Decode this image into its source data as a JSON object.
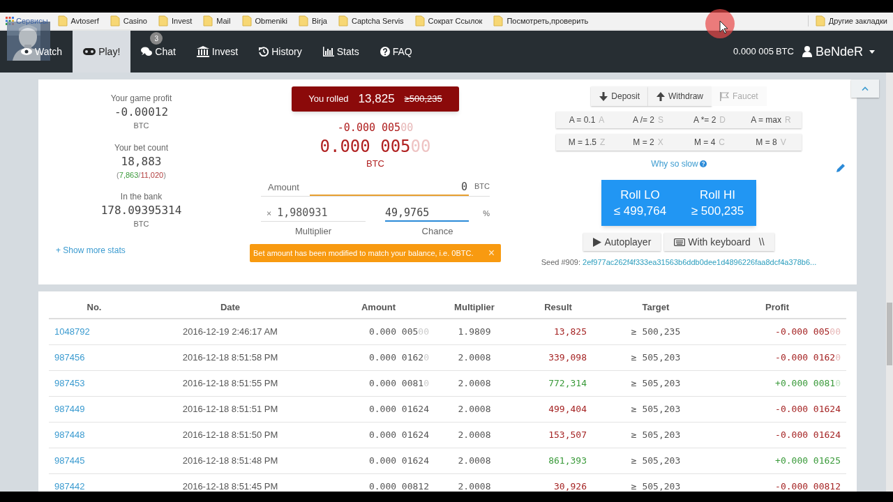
{
  "bookmarks_bar": {
    "apps_label": "Сервисы",
    "items": [
      "Avtoserf",
      "Casino",
      "Invest",
      "Mail",
      "Obmeniki",
      "Birja",
      "Captcha Servis",
      "Сократ Ссылок",
      "Посмотреть,проверить"
    ],
    "other": "Другие закладки"
  },
  "nav": {
    "items": [
      {
        "kind": "eye",
        "label": "Watch",
        "selected": false
      },
      {
        "kind": "gamepad",
        "label": "Play!",
        "selected": true
      },
      {
        "kind": "chat",
        "label": "Chat",
        "selected": false,
        "badge": "3"
      },
      {
        "kind": "bank",
        "label": "Invest",
        "selected": false
      },
      {
        "kind": "history",
        "label": "History",
        "selected": false
      },
      {
        "kind": "chart",
        "label": "Stats",
        "selected": false
      },
      {
        "kind": "question",
        "label": "FAQ",
        "selected": false
      }
    ],
    "balance": "0.000 005",
    "balance_unit": "BTC",
    "user": "BeNdeR"
  },
  "stats": [
    {
      "label": "Your game profit",
      "value": "-0.00012",
      "unit": "BTC"
    },
    {
      "label": "Your bet count",
      "value": "18,883",
      "bracket_open": "(",
      "wins": "7,863",
      "separator": "/",
      "losses": "11,020",
      "bracket_close": ")"
    },
    {
      "label": "In the bank",
      "value": "178.09395314",
      "unit": "BTC"
    }
  ],
  "show_more": "+ Show more stats",
  "roll_result": {
    "label": "You rolled",
    "value": "13,825",
    "target": "≥500,235",
    "met": false
  },
  "last_profit": {
    "text": "-0.000 005",
    "faded": "00"
  },
  "payout": {
    "text": "0.000 005",
    "faded": "00",
    "unit": "BTC"
  },
  "amount_field": {
    "label": "Amount",
    "value": "0",
    "unit": "BTC"
  },
  "multiplier_field": {
    "prefix": "×",
    "value": "1,980931",
    "label": "Multiplier"
  },
  "chance_field": {
    "value": "49,9765",
    "unit": "%",
    "label": "Chance"
  },
  "alert": {
    "text": "Bet amount has been modified to match your balance, i.e. 0BTC.",
    "close": "×"
  },
  "wallet_buttons": [
    {
      "kind": "down",
      "label": "Deposit",
      "disabled": false
    },
    {
      "kind": "up",
      "label": "Withdraw",
      "disabled": false
    },
    {
      "kind": "flag",
      "label": "Faucet",
      "disabled": true
    }
  ],
  "amount_shortcuts": [
    [
      {
        "label": "A = 0.1",
        "key": "A"
      },
      {
        "label": "A /= 2",
        "key": "S"
      },
      {
        "label": "A *= 2",
        "key": "D"
      },
      {
        "label": "A = max",
        "key": "R"
      }
    ],
    [
      {
        "label": "M = 1.5",
        "key": "Z"
      },
      {
        "label": "M = 2",
        "key": "X"
      },
      {
        "label": "M = 4",
        "key": "C"
      },
      {
        "label": "M = 8",
        "key": "V"
      }
    ]
  ],
  "why_slow": "Why so slow",
  "roll_buttons": [
    {
      "label": "Roll LO",
      "target": "≤ 499,764"
    },
    {
      "label": "Roll HI",
      "target": "≥ 500,235"
    }
  ],
  "mode_buttons": [
    {
      "kind": "play",
      "label": "Autoplayer"
    },
    {
      "kind": "keyboard",
      "label": "With keyboard",
      "key": "\\\\"
    }
  ],
  "seed": {
    "label": "Seed #909:",
    "hash": "2ef977ac262f4f333ea31563b6ddb0dee1d4896226faa8dcf4a378b6..."
  },
  "table": {
    "columns": [
      "No.",
      "Date",
      "Amount",
      "Multiplier",
      "Result",
      "Target",
      "Profit"
    ],
    "rows": [
      {
        "no": "1048792",
        "date": "2016-12-19 2:46:17 AM",
        "amount": {
          "text": "0.000 005",
          "faded": "00"
        },
        "multiplier": "1.9809",
        "result": "13,825",
        "target": "≥ 500,235",
        "profit": {
          "text": "-0.000 005",
          "faded": "00"
        },
        "won": false
      },
      {
        "no": "987456",
        "date": "2016-12-18 8:51:58 PM",
        "amount": {
          "text": "0.000 0162",
          "faded": "0"
        },
        "multiplier": "2.0008",
        "result": "339,098",
        "target": "≥ 505,203",
        "profit": {
          "text": "-0.000 0162",
          "faded": "0"
        },
        "won": false
      },
      {
        "no": "987453",
        "date": "2016-12-18 8:51:55 PM",
        "amount": {
          "text": "0.000 0081",
          "faded": "0"
        },
        "multiplier": "2.0008",
        "result": "772,314",
        "target": "≥ 505,203",
        "profit": {
          "text": "+0.000 0081",
          "faded": "0"
        },
        "won": true
      },
      {
        "no": "987449",
        "date": "2016-12-18 8:51:51 PM",
        "amount": {
          "text": "0.000 01624"
        },
        "multiplier": "2.0008",
        "result": "499,404",
        "target": "≥ 505,203",
        "profit": {
          "text": "-0.000 01624"
        },
        "won": false
      },
      {
        "no": "987448",
        "date": "2016-12-18 8:51:50 PM",
        "amount": {
          "text": "0.000 01624"
        },
        "multiplier": "2.0008",
        "result": "153,507",
        "target": "≥ 505,203",
        "profit": {
          "text": "-0.000 01624"
        },
        "won": false
      },
      {
        "no": "987445",
        "date": "2016-12-18 8:51:48 PM",
        "amount": {
          "text": "0.000 01624"
        },
        "multiplier": "2.0008",
        "result": "861,393",
        "target": "≥ 505,203",
        "profit": {
          "text": "+0.000 01625"
        },
        "won": true
      },
      {
        "no": "987442",
        "date": "2016-12-18 8:51:45 PM",
        "amount": {
          "text": "0.000 00812"
        },
        "multiplier": "2.0008",
        "result": "30,926",
        "target": "≥ 505,203",
        "profit": {
          "text": "-0.000 00812"
        },
        "won": false
      }
    ]
  }
}
